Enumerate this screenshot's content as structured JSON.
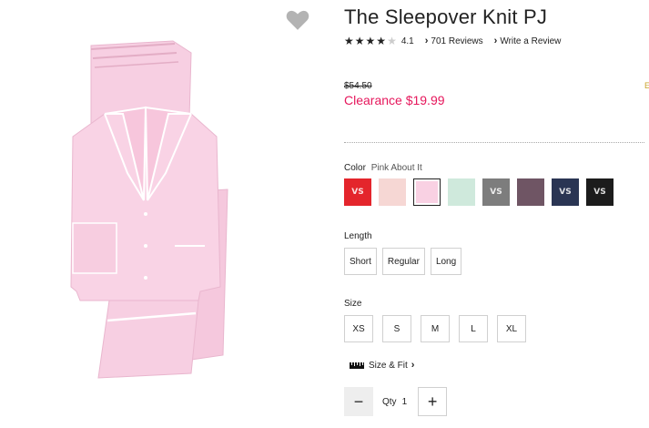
{
  "product": {
    "title": "The Sleepover Knit PJ",
    "rating": "4.1",
    "rating_value": 4.1,
    "reviews_label": "701 Reviews",
    "write_review_label": "Write a Review",
    "price_original": "$54.50",
    "price_clearance": "Clearance $19.99"
  },
  "color": {
    "label": "Color",
    "selected": "Pink About It",
    "swatches": [
      {
        "hex": "#e4252c",
        "mark": "VS"
      },
      {
        "hex": "#f6d7d4",
        "mark": ""
      },
      {
        "hex": "#f9d1e3",
        "mark": ""
      },
      {
        "hex": "#cfe9dc",
        "mark": ""
      },
      {
        "hex": "#7d7d7d",
        "mark": "VS"
      },
      {
        "hex": "#6f5564",
        "mark": ""
      },
      {
        "hex": "#2a3553",
        "mark": "VS"
      },
      {
        "hex": "#1c1c1c",
        "mark": "VS"
      }
    ],
    "selected_index": 2
  },
  "length": {
    "label": "Length",
    "options": [
      "Short",
      "Regular",
      "Long"
    ]
  },
  "size": {
    "label": "Size",
    "options": [
      "XS",
      "S",
      "M",
      "L",
      "XL"
    ]
  },
  "size_fit": {
    "label": "Size & Fit"
  },
  "quantity": {
    "label": "Qty",
    "value": "1",
    "minus": "−",
    "plus": "+"
  },
  "misc": {
    "edge_mark": "E"
  },
  "icons": {
    "wishlist": "heart-icon",
    "stars": "star-icon",
    "chevron": "chevron-right-icon",
    "ruler": "ruler-icon"
  }
}
